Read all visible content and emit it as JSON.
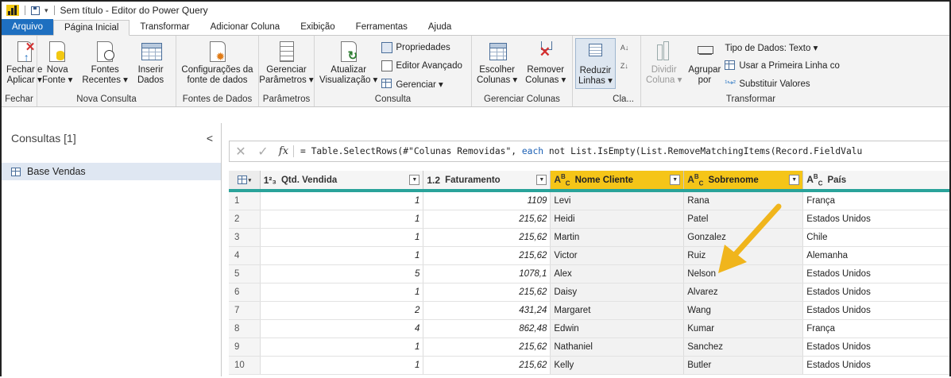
{
  "window": {
    "title": "Sem título - Editor do Power Query"
  },
  "tabs": [
    {
      "label": "Arquivo"
    },
    {
      "label": "Página Inicial"
    },
    {
      "label": "Transformar"
    },
    {
      "label": "Adicionar Coluna"
    },
    {
      "label": "Exibição"
    },
    {
      "label": "Ferramentas"
    },
    {
      "label": "Ajuda"
    }
  ],
  "ribbon": {
    "fechar": {
      "name": "Fechar",
      "close_apply": "Fechar e\nAplicar ▾"
    },
    "nova_consulta": {
      "name": "Nova Consulta",
      "nova_fonte": "Nova\nFonte ▾",
      "fontes_recentes": "Fontes\nRecentes ▾",
      "inserir_dados": "Inserir\nDados"
    },
    "fontes_dados": {
      "name": "Fontes de Dados",
      "config": "Configurações da\nfonte de dados"
    },
    "parametros": {
      "name": "Parâmetros",
      "gerenciar": "Gerenciar\nParâmetros ▾"
    },
    "consulta": {
      "name": "Consulta",
      "atualizar": "Atualizar\nVisualização ▾",
      "propriedades": "Propriedades",
      "editor_avancado": "Editor Avançado",
      "gerenciar": "Gerenciar ▾"
    },
    "gerenciar_colunas": {
      "name": "Gerenciar Colunas",
      "escolher": "Escolher\nColunas ▾",
      "remover": "Remover\nColunas ▾"
    },
    "reduzir": {
      "name": "Cla...",
      "reduzir_linhas": "Reduzir\nLinhas ▾"
    },
    "transformar": {
      "name": "Transformar",
      "dividir": "Dividir\nColuna ▾",
      "agrupar": "Agrupar\npor",
      "tipo_dados": "Tipo de Dados: Texto ▾",
      "primeira_linha": "Usar a Primeira Linha co",
      "substituir": "Substituir Valores"
    }
  },
  "left_panel": {
    "header": "Consultas [1]",
    "collapse": "<",
    "queries": [
      {
        "name": "Base Vendas"
      }
    ]
  },
  "formula_bar": {
    "cancel": "✕",
    "confirm": "✓",
    "fx": "fx",
    "part1": "= Table.SelectRows(#\"Colunas Removidas\", ",
    "keyword": "each",
    "part2": " not List.IsEmpty(List.RemoveMatchingItems(Record.FieldValu"
  },
  "grid": {
    "columns": [
      {
        "type": "1²₃",
        "name": "Qtd. Vendida"
      },
      {
        "type": "1.2",
        "name": "Faturamento"
      },
      {
        "type": "A<sup>B</sup><sub>C</sub>",
        "name": "Nome Cliente"
      },
      {
        "type": "A<sup>B</sup><sub>C</sub>",
        "name": "Sobrenome"
      },
      {
        "type": "A<sup>B</sup><sub>C</sub>",
        "name": "País"
      }
    ],
    "rows": [
      {
        "n": "1",
        "qtd": "1",
        "fat": "1109",
        "nome": "Levi",
        "sobrenome": "Rana",
        "pais": "França"
      },
      {
        "n": "2",
        "qtd": "1",
        "fat": "215,62",
        "nome": "Heidi",
        "sobrenome": "Patel",
        "pais": "Estados Unidos"
      },
      {
        "n": "3",
        "qtd": "1",
        "fat": "215,62",
        "nome": "Martin",
        "sobrenome": "Gonzalez",
        "pais": "Chile"
      },
      {
        "n": "4",
        "qtd": "1",
        "fat": "215,62",
        "nome": "Victor",
        "sobrenome": "Ruiz",
        "pais": "Alemanha"
      },
      {
        "n": "5",
        "qtd": "5",
        "fat": "1078,1",
        "nome": "Alex",
        "sobrenome": "Nelson",
        "pais": "Estados Unidos"
      },
      {
        "n": "6",
        "qtd": "1",
        "fat": "215,62",
        "nome": "Daisy",
        "sobrenome": "Alvarez",
        "pais": "Estados Unidos"
      },
      {
        "n": "7",
        "qtd": "2",
        "fat": "431,24",
        "nome": "Margaret",
        "sobrenome": "Wang",
        "pais": "Estados Unidos"
      },
      {
        "n": "8",
        "qtd": "4",
        "fat": "862,48",
        "nome": "Edwin",
        "sobrenome": "Kumar",
        "pais": "França"
      },
      {
        "n": "9",
        "qtd": "1",
        "fat": "215,62",
        "nome": "Nathaniel",
        "sobrenome": "Sanchez",
        "pais": "Estados Unidos"
      },
      {
        "n": "10",
        "qtd": "1",
        "fat": "215,62",
        "nome": "Kelly",
        "sobrenome": "Butler",
        "pais": "Estados Unidos"
      }
    ]
  },
  "colors": {
    "accent": "#1e6fc0",
    "selected_header": "#f5c518",
    "grid_line": "#2aa39a",
    "arrow": "#f0b51c"
  }
}
